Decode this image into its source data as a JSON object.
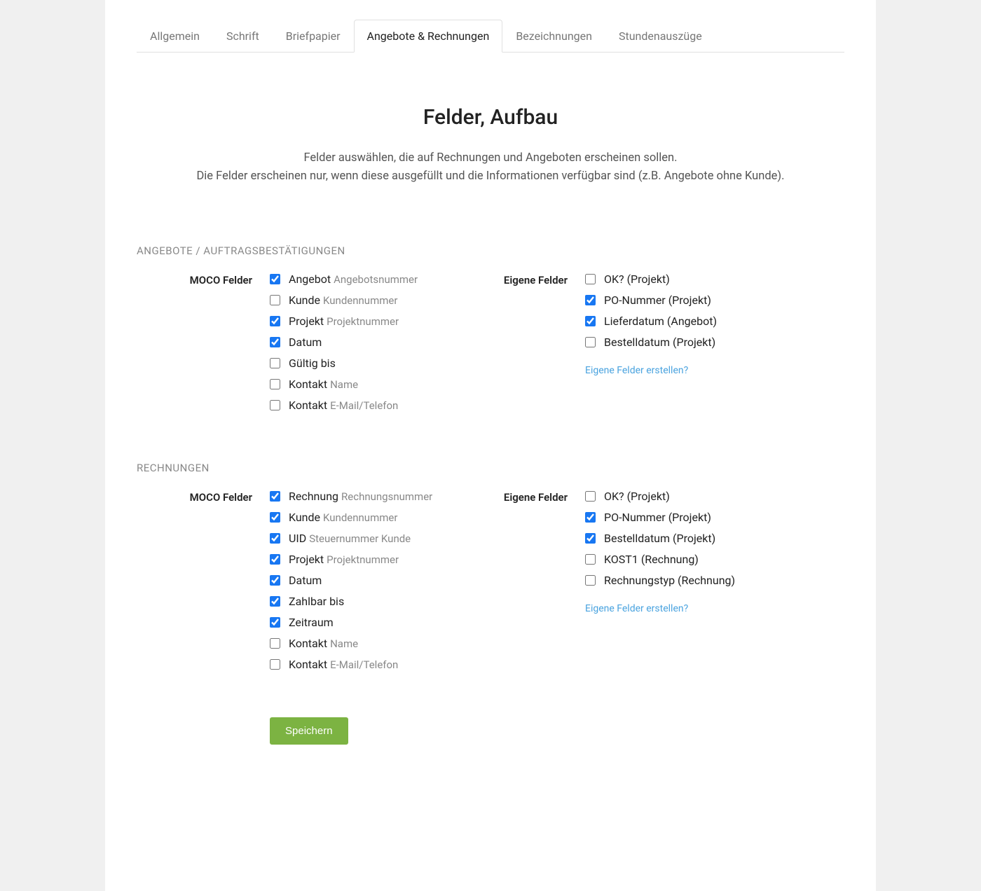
{
  "tabs": [
    {
      "label": "Allgemein"
    },
    {
      "label": "Schrift"
    },
    {
      "label": "Briefpapier"
    },
    {
      "label": "Angebote & Rechnungen"
    },
    {
      "label": "Bezeichnungen"
    },
    {
      "label": "Stundenauszüge"
    }
  ],
  "header": {
    "title": "Felder, Aufbau",
    "desc1": "Felder auswählen, die auf Rechnungen und Angeboten erscheinen sollen.",
    "desc2": "Die Felder erscheinen nur, wenn diese ausgefüllt und die Informationen verfügbar sind (z.B. Angebote ohne Kunde)."
  },
  "labels": {
    "moco_felder": "MOCO Felder",
    "eigene_felder": "Eigene Felder",
    "create_link": "Eigene Felder erstellen?",
    "save": "Speichern"
  },
  "section_offers": {
    "heading": "ANGEBOTE / AUFTRAGSBESTÄTIGUNGEN",
    "moco": [
      {
        "main": "Angebot",
        "sub": "Angebotsnummer",
        "checked": true
      },
      {
        "main": "Kunde",
        "sub": "Kundennummer",
        "checked": false
      },
      {
        "main": "Projekt",
        "sub": "Projektnummer",
        "checked": true
      },
      {
        "main": "Datum",
        "sub": "",
        "checked": true
      },
      {
        "main": "Gültig bis",
        "sub": "",
        "checked": false
      },
      {
        "main": "Kontakt",
        "sub": "Name",
        "checked": false
      },
      {
        "main": "Kontakt",
        "sub": "E-Mail/Telefon",
        "checked": false
      }
    ],
    "custom": [
      {
        "main": "OK? (Projekt)",
        "checked": false
      },
      {
        "main": "PO-Nummer (Projekt)",
        "checked": true
      },
      {
        "main": "Lieferdatum (Angebot)",
        "checked": true
      },
      {
        "main": "Bestelldatum (Projekt)",
        "checked": false
      }
    ]
  },
  "section_invoices": {
    "heading": "RECHNUNGEN",
    "moco": [
      {
        "main": "Rechnung",
        "sub": "Rechnungsnummer",
        "checked": true
      },
      {
        "main": "Kunde",
        "sub": "Kundennummer",
        "checked": true
      },
      {
        "main": "UID",
        "sub": "Steuernummer Kunde",
        "checked": true
      },
      {
        "main": "Projekt",
        "sub": "Projektnummer",
        "checked": true
      },
      {
        "main": "Datum",
        "sub": "",
        "checked": true
      },
      {
        "main": "Zahlbar bis",
        "sub": "",
        "checked": true
      },
      {
        "main": "Zeitraum",
        "sub": "",
        "checked": true
      },
      {
        "main": "Kontakt",
        "sub": "Name",
        "checked": false
      },
      {
        "main": "Kontakt",
        "sub": "E-Mail/Telefon",
        "checked": false
      }
    ],
    "custom": [
      {
        "main": "OK? (Projekt)",
        "checked": false
      },
      {
        "main": "PO-Nummer (Projekt)",
        "checked": true
      },
      {
        "main": "Bestelldatum (Projekt)",
        "checked": true
      },
      {
        "main": "KOST1 (Rechnung)",
        "checked": false
      },
      {
        "main": "Rechnungstyp (Rechnung)",
        "checked": false
      }
    ]
  }
}
